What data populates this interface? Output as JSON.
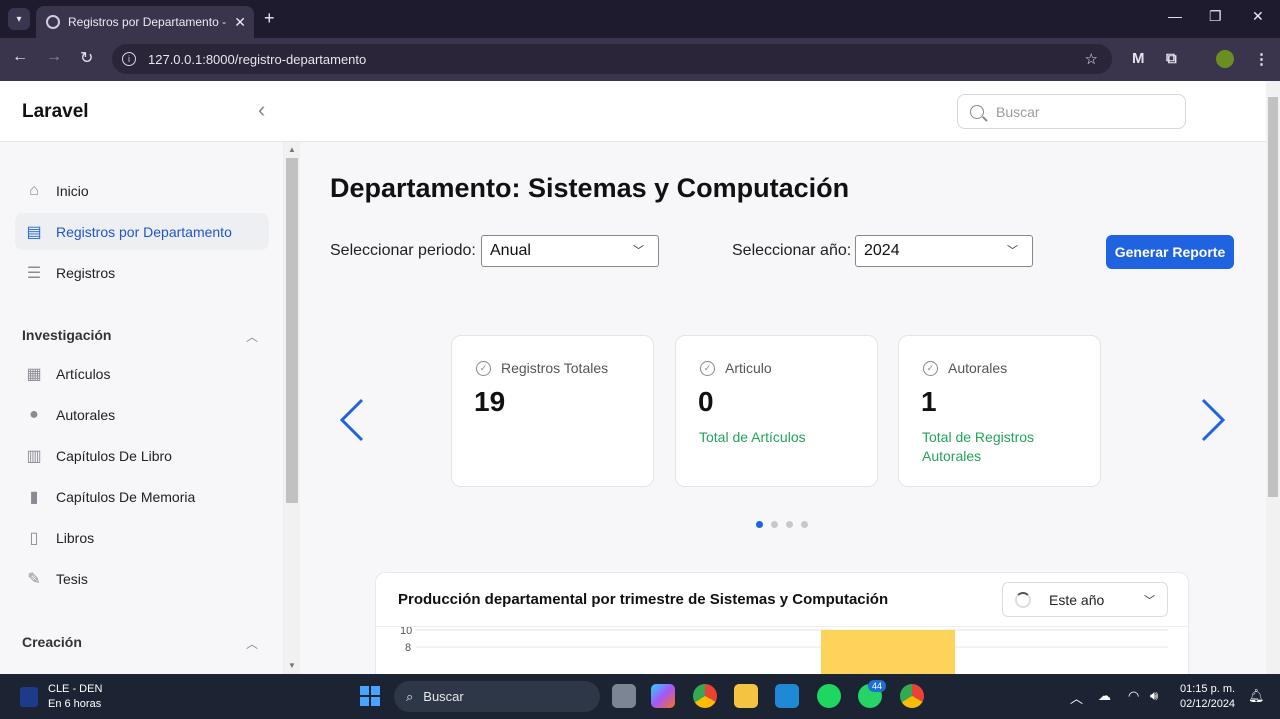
{
  "browser": {
    "tab_title": "Registros por Departamento - L",
    "url": "127.0.0.1:8000/registro-departamento"
  },
  "header": {
    "brand": "Laravel",
    "search_placeholder": "Buscar"
  },
  "sidebar": {
    "items": [
      {
        "label": "Inicio",
        "icon": "home-icon"
      },
      {
        "label": "Registros por Departamento",
        "icon": "document-icon",
        "active": true
      },
      {
        "label": "Registros",
        "icon": "stack-icon"
      }
    ],
    "sections": [
      {
        "title": "Investigación",
        "items": [
          {
            "label": "Artículos",
            "icon": "newspaper-icon"
          },
          {
            "label": "Autorales",
            "icon": "user-icon"
          },
          {
            "label": "Capítulos De Libro",
            "icon": "book-open-icon"
          },
          {
            "label": "Capítulos De Memoria",
            "icon": "file-icon"
          },
          {
            "label": "Libros",
            "icon": "bookmark-icon"
          },
          {
            "label": "Tesis",
            "icon": "pencil-square-icon"
          }
        ]
      },
      {
        "title": "Creación",
        "items": []
      }
    ]
  },
  "main": {
    "title": "Departamento: Sistemas y Computación",
    "period_label": "Seleccionar periodo:",
    "period_value": "Anual",
    "year_label": "Seleccionar año:",
    "year_value": "2024",
    "generate_button": "Generar Reporte",
    "cards": [
      {
        "title": "Registros Totales",
        "value": "19",
        "subtitle": ""
      },
      {
        "title": "Articulo",
        "value": "0",
        "subtitle": "Total de Artículos"
      },
      {
        "title": "Autorales",
        "value": "1",
        "subtitle": "Total de Registros Autorales"
      }
    ],
    "carousel_active_dot": 0,
    "carousel_dots": 4,
    "chart": {
      "title": "Producción departamental por trimestre de Sistemas y Computación",
      "range": "Este año",
      "y_ticks": [
        "10",
        "8"
      ]
    },
    "accent": "#1f63e0",
    "bar_color": "#fdd35a"
  },
  "taskbar": {
    "weather_line1": "CLE - DEN",
    "weather_line2": "En 6 horas",
    "search": "Buscar",
    "whatsapp_badge": "44",
    "time": "01:15 p. m.",
    "date": "02/12/2024"
  }
}
